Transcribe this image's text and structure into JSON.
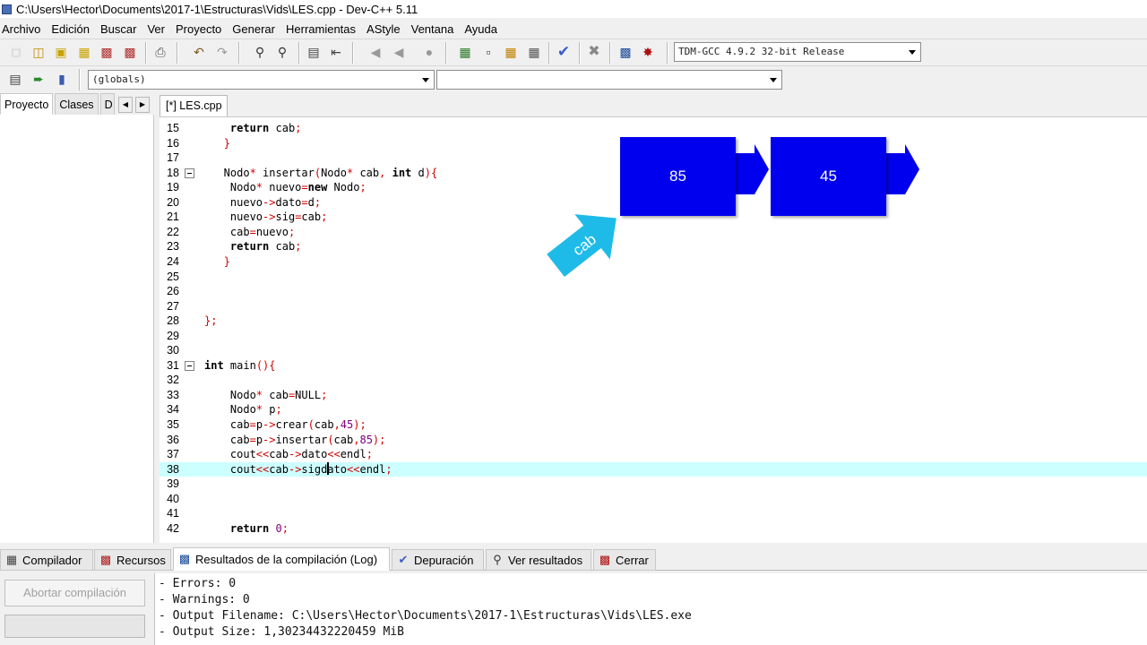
{
  "window": {
    "title": "C:\\Users\\Hector\\Documents\\2017-1\\Estructuras\\Vids\\LES.cpp - Dev-C++ 5.11"
  },
  "menu": [
    "Archivo",
    "Edición",
    "Buscar",
    "Ver",
    "Proyecto",
    "Generar",
    "Herramientas",
    "AStyle",
    "Ventana",
    "Ayuda"
  ],
  "toolbar": {
    "compiler_select": "TDM-GCC 4.9.2 32-bit Release"
  },
  "toolbar2": {
    "scope_select": "(globals)",
    "member_select": ""
  },
  "left_panel": {
    "tabs": [
      "Proyecto",
      "Clases",
      "D"
    ]
  },
  "editor": {
    "tab_label": "[*] LES.cpp",
    "lines": [
      {
        "n": "15",
        "code": "    return cab;"
      },
      {
        "n": "16",
        "code": "   }"
      },
      {
        "n": "17",
        "code": ""
      },
      {
        "n": "18",
        "code": "   Nodo* insertar(Nodo* cab, int d){"
      },
      {
        "n": "19",
        "code": "    Nodo* nuevo=new Nodo;"
      },
      {
        "n": "20",
        "code": "    nuevo->dato=d;"
      },
      {
        "n": "21",
        "code": "    nuevo->sig=cab;"
      },
      {
        "n": "22",
        "code": "    cab=nuevo;"
      },
      {
        "n": "23",
        "code": "    return cab;"
      },
      {
        "n": "24",
        "code": "   }"
      },
      {
        "n": "25",
        "code": ""
      },
      {
        "n": "26",
        "code": ""
      },
      {
        "n": "27",
        "code": ""
      },
      {
        "n": "28",
        "code": "};"
      },
      {
        "n": "29",
        "code": ""
      },
      {
        "n": "30",
        "code": ""
      },
      {
        "n": "31",
        "code": "int main(){"
      },
      {
        "n": "32",
        "code": ""
      },
      {
        "n": "33",
        "code": "    Nodo* cab=NULL;"
      },
      {
        "n": "34",
        "code": "    Nodo* p;"
      },
      {
        "n": "35",
        "code": "    cab=p->crear(cab,45);"
      },
      {
        "n": "36",
        "code": "    cab=p->insertar(cab,85);"
      },
      {
        "n": "37",
        "code": "    cout<<cab->dato<<endl;"
      },
      {
        "n": "38",
        "code": "    cout<<cab->sigdato<<endl;"
      },
      {
        "n": "39",
        "code": ""
      },
      {
        "n": "40",
        "code": ""
      },
      {
        "n": "41",
        "code": ""
      },
      {
        "n": "42",
        "code": "    return 0;"
      }
    ]
  },
  "diagram": {
    "node1": "85",
    "node2": "45",
    "pointer": "cab"
  },
  "bottom_tabs": [
    "Compilador",
    "Recursos",
    "Resultados de la compilación (Log)",
    "Depuración",
    "Ver resultados",
    "Cerrar"
  ],
  "bottom": {
    "abort_button": "Abortar compilación",
    "log": [
      "- Errors: 0",
      "- Warnings: 0",
      "- Output Filename: C:\\Users\\Hector\\Documents\\2017-1\\Estructuras\\Vids\\LES.exe",
      "- Output Size: 1,30234432220459 MiB"
    ]
  }
}
